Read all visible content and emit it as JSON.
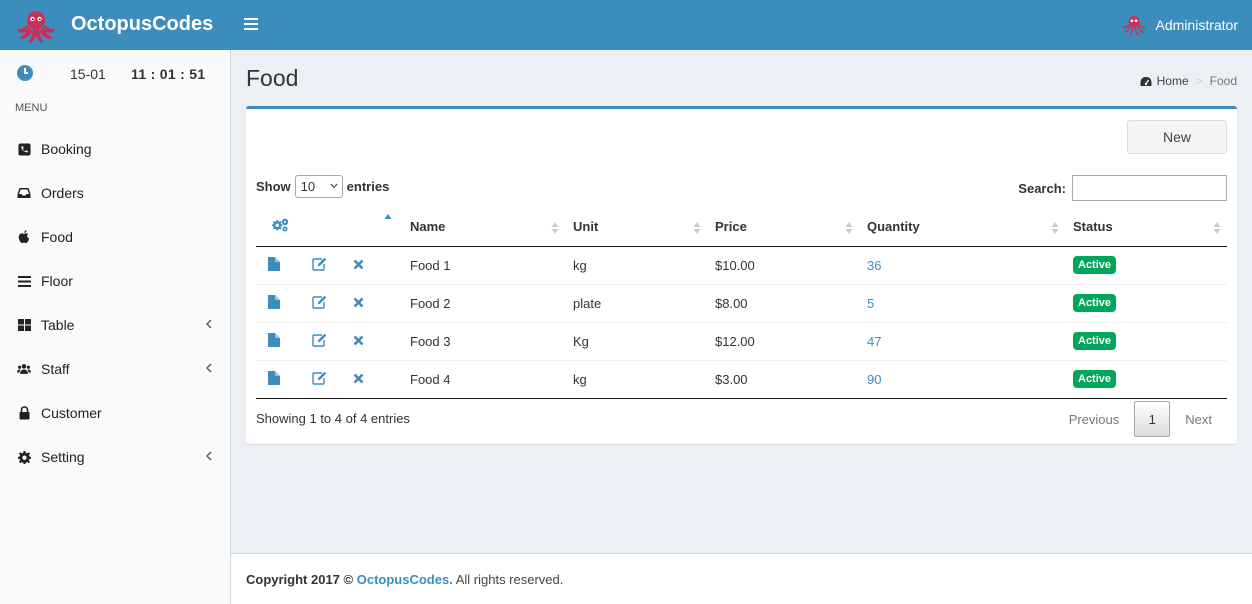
{
  "header": {
    "brand": "OctopusCodes",
    "brand_icon": "octopus-logo",
    "menu_icon": "hamburger-icon",
    "user_name": "Administrator",
    "colors": {
      "primary": "#3c8dbc",
      "success": "#00a65a"
    }
  },
  "sidebar": {
    "clock": {
      "date": "15-01",
      "time": "11 : 01 : 51"
    },
    "menu_header": "MENU",
    "items": [
      {
        "label": "Booking",
        "icon": "phone-icon",
        "has_submenu": false
      },
      {
        "label": "Orders",
        "icon": "inbox-icon",
        "has_submenu": false
      },
      {
        "label": "Food",
        "icon": "apple-icon",
        "has_submenu": false
      },
      {
        "label": "Floor",
        "icon": "bars-icon",
        "has_submenu": false
      },
      {
        "label": "Table",
        "icon": "grid-icon",
        "has_submenu": true
      },
      {
        "label": "Staff",
        "icon": "users-icon",
        "has_submenu": true
      },
      {
        "label": "Customer",
        "icon": "lock-icon",
        "has_submenu": false
      },
      {
        "label": "Setting",
        "icon": "gear-icon",
        "has_submenu": true
      }
    ]
  },
  "page": {
    "title": "Food",
    "breadcrumb": {
      "home": "Home",
      "current": "Food"
    }
  },
  "box": {
    "new_button": "New",
    "show_label": "Show",
    "entries_value": "10",
    "entries_label": "entries",
    "search_label": "Search:",
    "search_value": "",
    "columns": [
      "Name",
      "Unit",
      "Price",
      "Quantity",
      "Status"
    ],
    "rows": [
      {
        "name": "Food 1",
        "unit": "kg",
        "price": "$10.00",
        "quantity": "36",
        "status": "Active"
      },
      {
        "name": "Food 2",
        "unit": "plate",
        "price": "$8.00",
        "quantity": "5",
        "status": "Active"
      },
      {
        "name": "Food 3",
        "unit": "Kg",
        "price": "$12.00",
        "quantity": "47",
        "status": "Active"
      },
      {
        "name": "Food 4",
        "unit": "kg",
        "price": "$3.00",
        "quantity": "90",
        "status": "Active"
      }
    ],
    "info": "Showing 1 to 4 of 4 entries",
    "pagination": {
      "previous": "Previous",
      "current": "1",
      "next": "Next"
    }
  },
  "footer": {
    "prefix": "Copyright 2017 ©",
    "link": "OctopusCodes.",
    "suffix": "All rights reserved."
  }
}
